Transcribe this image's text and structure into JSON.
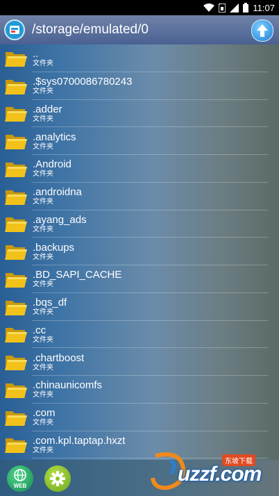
{
  "status_bar": {
    "time": "11:07"
  },
  "header": {
    "path": "/storage/emulated/0"
  },
  "files": [
    {
      "name": "..",
      "type": "文件夹"
    },
    {
      "name": ".$sys0700086780243",
      "type": "文件夹"
    },
    {
      "name": ".adder",
      "type": "文件夹"
    },
    {
      "name": ".analytics",
      "type": "文件夹"
    },
    {
      "name": ".Android",
      "type": "文件夹"
    },
    {
      "name": ".androidna",
      "type": "文件夹"
    },
    {
      "name": ".ayang_ads",
      "type": "文件夹"
    },
    {
      "name": ".backups",
      "type": "文件夹"
    },
    {
      "name": ".BD_SAPI_CACHE",
      "type": "文件夹"
    },
    {
      "name": ".bqs_df",
      "type": "文件夹"
    },
    {
      "name": ".cc",
      "type": "文件夹"
    },
    {
      "name": ".chartboost",
      "type": "文件夹"
    },
    {
      "name": ".chinaunicomfs",
      "type": "文件夹"
    },
    {
      "name": ".com",
      "type": "文件夹"
    },
    {
      "name": ".com.kpl.taptap.hxzt",
      "type": "文件夹"
    }
  ],
  "bottom": {
    "web_label": "WEB"
  },
  "watermark": {
    "brand": "uzzf.com",
    "tag": "东坡下载"
  },
  "colors": {
    "header": "#5a6f9c",
    "folder": "#f2c21b",
    "web": "#1fa85e",
    "settings": "#86c42a"
  },
  "icons": {
    "app": "file-manager-app-icon",
    "up": "arrow-up-icon",
    "folder": "folder-icon",
    "web": "globe-icon",
    "settings": "gear-icon"
  }
}
